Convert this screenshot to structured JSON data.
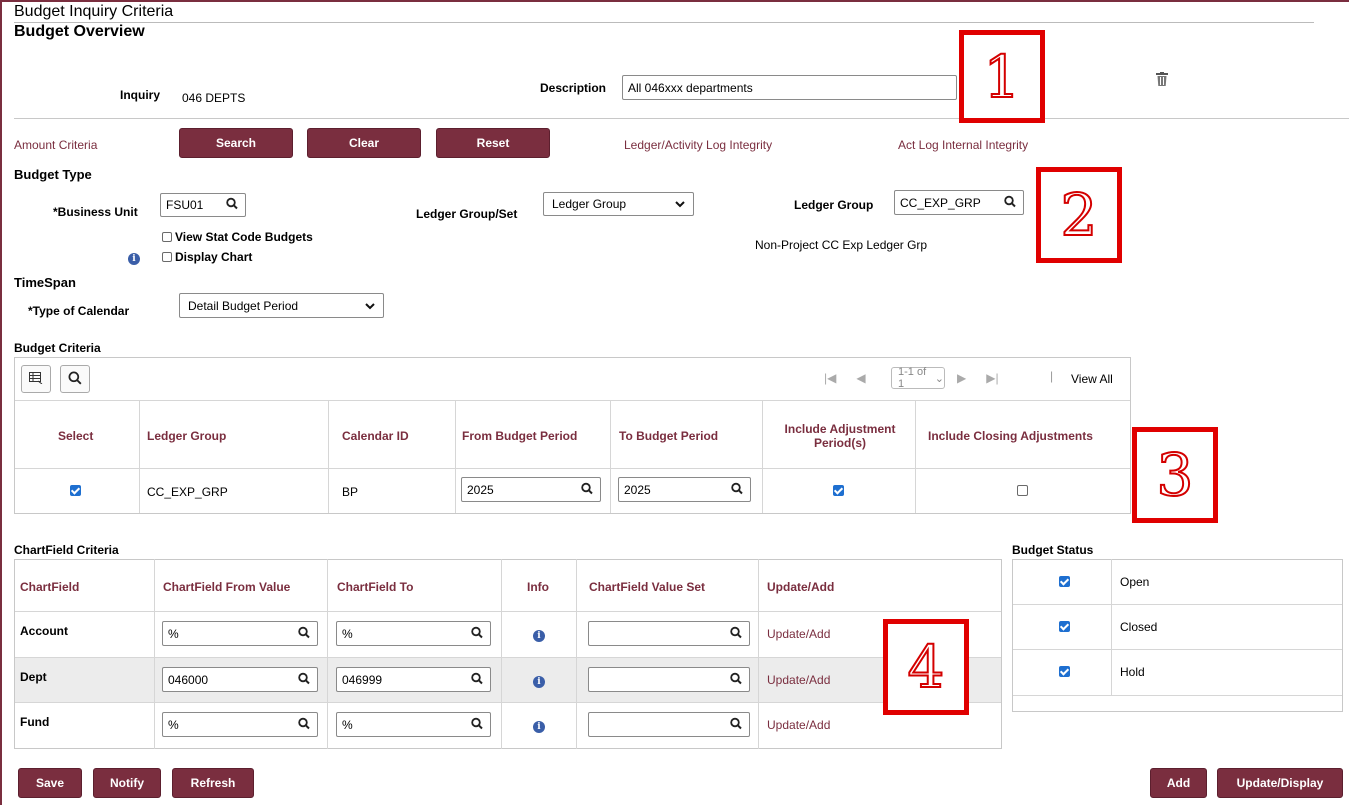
{
  "page": {
    "title": "Budget Inquiry Criteria",
    "subtitle": "Budget Overview"
  },
  "header": {
    "inquiry_label": "Inquiry",
    "inquiry_value": "046 DEPTS",
    "description_label": "Description",
    "description_value": "All 046xxx departments"
  },
  "toolbar": {
    "amount_criteria": "Amount Criteria",
    "search": "Search",
    "clear": "Clear",
    "reset": "Reset",
    "ledger_integrity": "Ledger/Activity Log Integrity",
    "actlog_integrity": "Act Log Internal Integrity"
  },
  "budget_type": {
    "heading": "Budget Type",
    "business_unit_label": "*Business Unit",
    "business_unit_value": "FSU01",
    "view_stat": "View Stat Code Budgets",
    "display_chart": "Display Chart",
    "ledger_groupset_label": "Ledger Group/Set",
    "ledger_groupset_value": "Ledger Group",
    "ledger_group_label": "Ledger Group",
    "ledger_group_value": "CC_EXP_GRP",
    "ledger_group_desc": "Non-Project CC Exp Ledger Grp"
  },
  "timespan": {
    "heading": "TimeSpan",
    "calendar_label": "*Type of Calendar",
    "calendar_value": "Detail Budget Period"
  },
  "budget_criteria": {
    "heading": "Budget Criteria",
    "pager": "1-1 of 1",
    "view_all": "View All",
    "columns": [
      "Select",
      "Ledger Group",
      "Calendar ID",
      "From Budget Period",
      "To Budget Period",
      "Include Adjustment Period(s)",
      "Include Closing Adjustments"
    ],
    "row": {
      "ledger_group": "CC_EXP_GRP",
      "calendar_id": "BP",
      "from": "2025",
      "to": "2025",
      "select": true,
      "include_adj": true,
      "include_closing": false
    }
  },
  "chartfield": {
    "heading": "ChartField Criteria",
    "columns": [
      "ChartField",
      "ChartField From Value",
      "ChartField To",
      "Info",
      "ChartField Value Set",
      "Update/Add"
    ],
    "rows": [
      {
        "name": "Account",
        "from": "%",
        "to": "%",
        "value_set": "",
        "link": "Update/Add"
      },
      {
        "name": "Dept",
        "from": "046000",
        "to": "046999",
        "value_set": "",
        "link": "Update/Add"
      },
      {
        "name": "Fund",
        "from": "%",
        "to": "%",
        "value_set": "",
        "link": "Update/Add"
      }
    ]
  },
  "budget_status": {
    "heading": "Budget Status",
    "items": [
      {
        "label": "Open",
        "checked": true
      },
      {
        "label": "Closed",
        "checked": true
      },
      {
        "label": "Hold",
        "checked": true
      }
    ]
  },
  "footer": {
    "save": "Save",
    "notify": "Notify",
    "refresh": "Refresh",
    "add": "Add",
    "update_display": "Update/Display"
  },
  "callouts": [
    "1",
    "2",
    "3",
    "4"
  ],
  "colors": {
    "accent": "#7a2e3f",
    "callout": "#e00000",
    "checkbox": "#1e6fd0"
  },
  "icons": {
    "search": "magnifier-icon",
    "trash": "trash-icon",
    "info": "info-icon",
    "chevron": "chevron-down-icon"
  }
}
